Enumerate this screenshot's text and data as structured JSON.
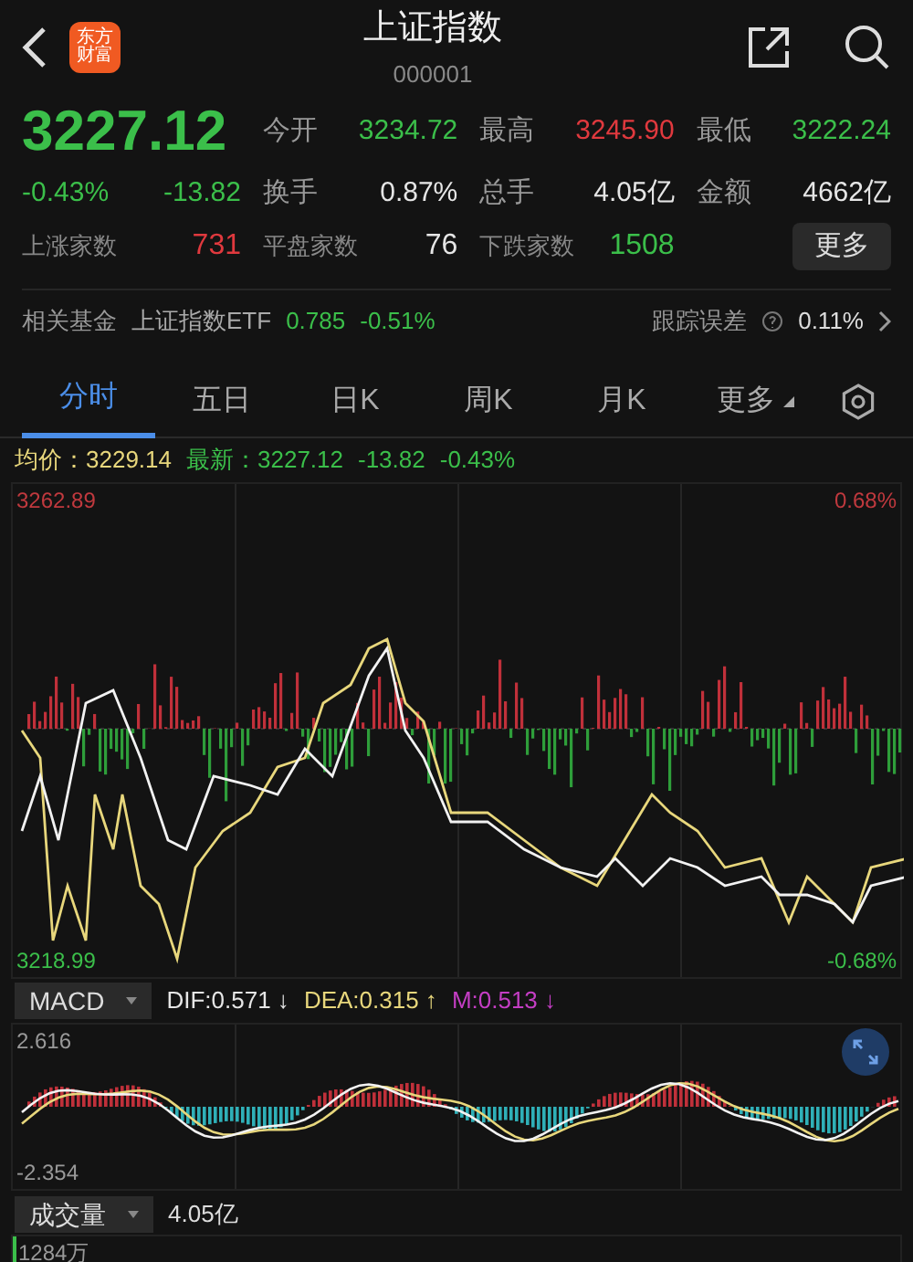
{
  "header": {
    "logo_lines": [
      "东方",
      "财富"
    ],
    "title": "上证指数",
    "code": "000001"
  },
  "quote": {
    "price": "3227.12",
    "change_pct": "-0.43%",
    "change": "-13.82",
    "stats": [
      {
        "label": "今开",
        "value": "3234.72",
        "color": "#3bbf4a"
      },
      {
        "label": "最高",
        "value": "3245.90",
        "color": "#e0393e"
      },
      {
        "label": "最低",
        "value": "3222.24",
        "color": "#3bbf4a"
      },
      {
        "label": "换手",
        "value": "0.87%",
        "color": "#e6e6e6"
      },
      {
        "label": "总手",
        "value": "4.05亿",
        "color": "#e6e6e6"
      },
      {
        "label": "金额",
        "value": "4662亿",
        "color": "#e6e6e6"
      }
    ],
    "breadth": [
      {
        "label": "上涨家数",
        "value": "731",
        "color": "#e0393e"
      },
      {
        "label": "平盘家数",
        "value": "76",
        "color": "#e6e6e6"
      },
      {
        "label": "下跌家数",
        "value": "1508",
        "color": "#3bbf4a"
      }
    ],
    "more_button": "更多"
  },
  "fund": {
    "label": "相关基金",
    "name": "上证指数ETF",
    "price": "0.785",
    "change": "-0.51%",
    "tracking_label": "跟踪误差",
    "tracking_value": "0.11%"
  },
  "tabs": [
    {
      "label": "分时",
      "selected": true,
      "kind": "tab"
    },
    {
      "label": "五日",
      "selected": false,
      "kind": "tab"
    },
    {
      "label": "日K",
      "selected": false,
      "kind": "tab"
    },
    {
      "label": "周K",
      "selected": false,
      "kind": "tab"
    },
    {
      "label": "月K",
      "selected": false,
      "kind": "tab"
    },
    {
      "label": "更多",
      "selected": false,
      "kind": "menu"
    }
  ],
  "price_bar": {
    "avg_label": "均价：",
    "avg": "3229.14",
    "last_label": "最新：",
    "last": "3227.12",
    "change": "-13.82",
    "change_pct": "-0.43%"
  },
  "price_chart": {
    "max": "3262.89",
    "max_pct": "0.68%",
    "min": "3218.99",
    "min_pct": "-0.68%"
  },
  "macd": {
    "selector": "MACD",
    "indicators": [
      {
        "text": "DIF:0.571 ↓",
        "color": "#e6e6e6"
      },
      {
        "text": "DEA:0.315 ↑",
        "color": "#e8d77c"
      },
      {
        "text": "M:0.513 ↓",
        "color": "#c43ec4"
      }
    ],
    "max": "2.616",
    "min": "-2.354"
  },
  "volume": {
    "selector": "成交量",
    "value": "4.05亿",
    "max": "1284万"
  }
}
